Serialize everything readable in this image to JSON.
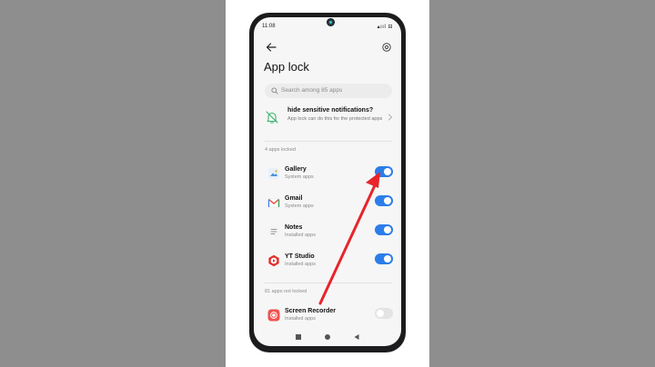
{
  "status_bar": {
    "time": "11:08",
    "icons": "▴ııl ⊟"
  },
  "header": {
    "title": "App lock",
    "back_icon": "arrow-left-icon",
    "settings_icon": "gear-icon"
  },
  "search": {
    "placeholder": "Search among 85 apps"
  },
  "notice": {
    "title": "hide sensitive notifications?",
    "description": "App lock can do this for the protected apps"
  },
  "locked_section": {
    "label": "4 apps locked",
    "apps": [
      {
        "name": "Gallery",
        "category": "System apps",
        "locked": true
      },
      {
        "name": "Gmail",
        "category": "System apps",
        "locked": true
      },
      {
        "name": "Notes",
        "category": "Installed apps",
        "locked": true
      },
      {
        "name": "YT Studio",
        "category": "Installed apps",
        "locked": true
      }
    ]
  },
  "unlocked_section": {
    "label": "81 apps not locked",
    "apps": [
      {
        "name": "Screen Recorder",
        "category": "Installed apps",
        "locked": false
      }
    ]
  },
  "colors": {
    "toggle_on": "#2b7de9",
    "toggle_off": "#e4e4e4",
    "arrow": "#e8242a",
    "bell": "#3cb371"
  }
}
